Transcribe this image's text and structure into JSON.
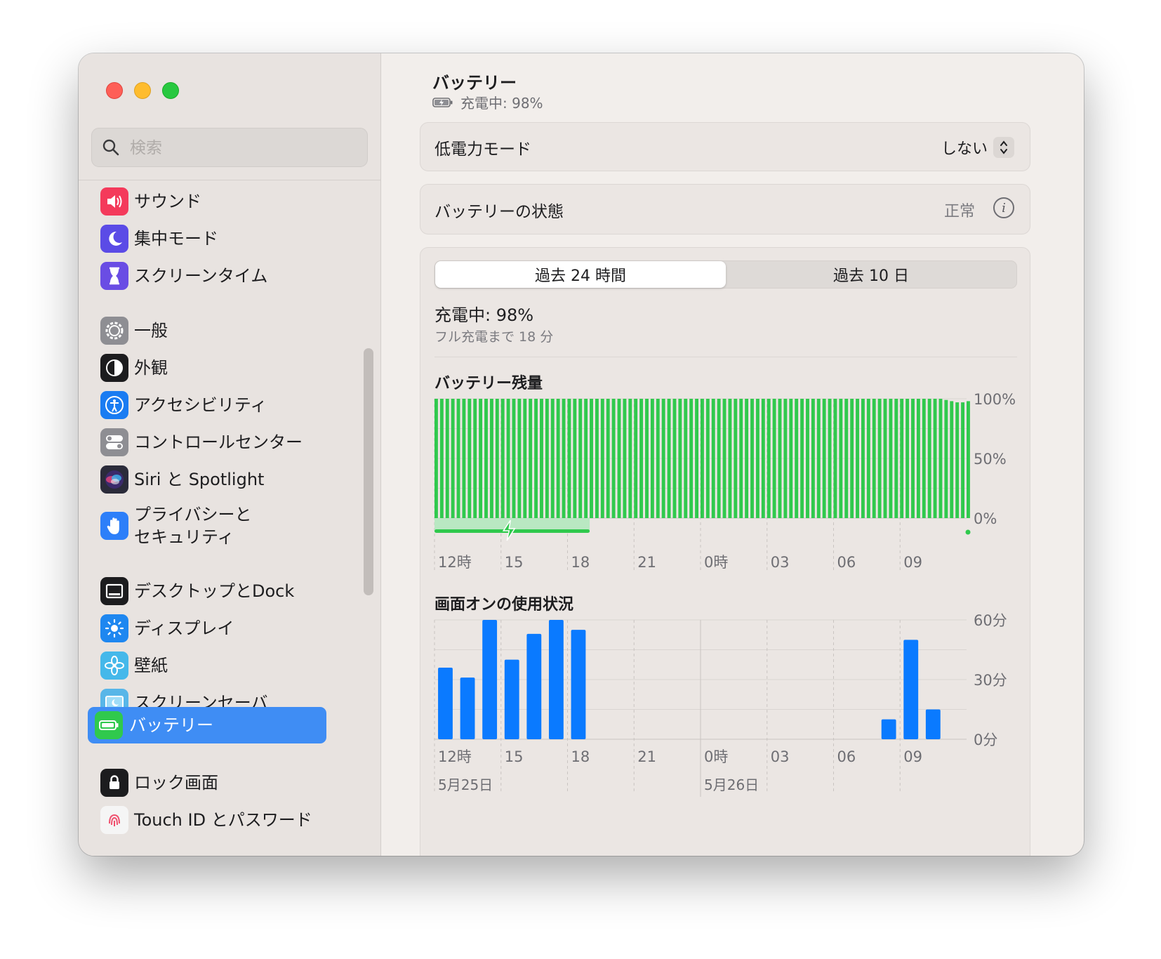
{
  "window": {
    "title": "バッテリー",
    "subtitle": "充電中: 98%"
  },
  "sidebar": {
    "search_placeholder": "検索",
    "items": [
      {
        "label": "サウンド",
        "icon": "speaker-icon",
        "color": "#f43a5b"
      },
      {
        "label": "集中モード",
        "icon": "moon-icon",
        "color": "#5b4be6"
      },
      {
        "label": "スクリーンタイム",
        "icon": "hourglass-icon",
        "color": "#6a4de4"
      },
      {
        "label": "一般",
        "icon": "gear-icon",
        "color": "#8e8e93"
      },
      {
        "label": "外観",
        "icon": "appearance-icon",
        "color": "#1c1c1e"
      },
      {
        "label": "アクセシビリティ",
        "icon": "accessibility-icon",
        "color": "#1a7cf2"
      },
      {
        "label": "コントロールセンター",
        "icon": "toggles-icon",
        "color": "#8e8e93"
      },
      {
        "label": "Siri と Spotlight",
        "icon": "siri-icon",
        "color": "#2b2b3a"
      },
      {
        "label": "プライバシーと\nセキュリティ",
        "icon": "hand-icon",
        "color": "#2d7ff9"
      },
      {
        "label": "デスクトップとDock",
        "icon": "dock-icon",
        "color": "#1c1c1e"
      },
      {
        "label": "ディスプレイ",
        "icon": "sun-icon",
        "color": "#1e87f0"
      },
      {
        "label": "壁紙",
        "icon": "flower-icon",
        "color": "#45b8ea"
      },
      {
        "label": "スクリーンセーバ",
        "icon": "screensaver-icon",
        "color": "#58b6e8"
      },
      {
        "label": "バッテリー",
        "icon": "battery-icon",
        "color": "#30c94d",
        "selected": true
      },
      {
        "label": "ロック画面",
        "icon": "lock-icon",
        "color": "#1c1c1e"
      },
      {
        "label": "Touch ID とパスワード",
        "icon": "fingerprint-icon",
        "color": "#f5f5f5"
      }
    ]
  },
  "low_power": {
    "label": "低電力モード",
    "value": "しない"
  },
  "health": {
    "label": "バッテリーの状態",
    "value": "正常"
  },
  "tabs": {
    "tab1": "過去 24 時間",
    "tab2": "過去 10 日",
    "active": 0
  },
  "charge": {
    "status": "充電中: 98%",
    "note": "フル充電まで 18 分"
  },
  "colors": {
    "accent": "#3f8df4",
    "battery_green": "#30c94d",
    "usage_blue": "#0a7aff"
  },
  "battery_chart": {
    "title": "バッテリー残量",
    "y_ticks": [
      "100%",
      "50%",
      "0%"
    ],
    "x_ticks": [
      "12時",
      "15",
      "18",
      "21",
      "0時",
      "03",
      "06",
      "09"
    ]
  },
  "usage_chart": {
    "title": "画面オンの使用状況",
    "y_ticks": [
      "60分",
      "30分",
      "0分"
    ],
    "x_ticks": [
      "12時",
      "15",
      "18",
      "21",
      "0時",
      "03",
      "06",
      "09"
    ],
    "date_labels": [
      "5月25日",
      "5月26日"
    ]
  },
  "chart_data": [
    {
      "type": "bar",
      "title": "バッテリー残量",
      "ylabel": "",
      "ylim": [
        0,
        100
      ],
      "x_ticks": [
        "12時",
        "15",
        "18",
        "21",
        "0時",
        "03",
        "06",
        "09"
      ],
      "x_range_hours": [
        12,
        35.5
      ],
      "bar_interval_minutes": 15,
      "values_note": "97 bars, every 15 min starting 12時",
      "values": [
        100,
        100,
        100,
        100,
        100,
        100,
        100,
        100,
        100,
        100,
        100,
        100,
        100,
        100,
        100,
        100,
        100,
        100,
        100,
        100,
        100,
        100,
        100,
        100,
        100,
        100,
        100,
        100,
        100,
        100,
        100,
        100,
        100,
        100,
        100,
        100,
        100,
        100,
        100,
        100,
        100,
        100,
        100,
        100,
        100,
        100,
        100,
        100,
        100,
        100,
        100,
        100,
        100,
        100,
        100,
        100,
        100,
        100,
        100,
        100,
        100,
        100,
        100,
        100,
        100,
        100,
        100,
        100,
        100,
        100,
        100,
        100,
        100,
        100,
        100,
        100,
        100,
        100,
        100,
        100,
        100,
        100,
        100,
        100,
        100,
        100,
        100,
        100,
        100,
        100,
        100,
        100,
        99,
        98,
        97,
        97,
        98
      ],
      "charging_periods": [
        [
          12,
          19
        ]
      ],
      "grid": true
    },
    {
      "type": "bar",
      "title": "画面オンの使用状況",
      "ylabel": "",
      "ylim": [
        0,
        60
      ],
      "x_ticks": [
        "12時",
        "15",
        "18",
        "21",
        "0時",
        "03",
        "06",
        "09"
      ],
      "bars": [
        {
          "hour": 12,
          "value": 36
        },
        {
          "hour": 13,
          "value": 31
        },
        {
          "hour": 14,
          "value": 60
        },
        {
          "hour": 15,
          "value": 40
        },
        {
          "hour": 16,
          "value": 53
        },
        {
          "hour": 17,
          "value": 60
        },
        {
          "hour": 18,
          "value": 55
        },
        {
          "hour": 32,
          "value": 10
        },
        {
          "hour": 33,
          "value": 50
        },
        {
          "hour": 34,
          "value": 15
        }
      ],
      "date_labels": [
        "5月25日",
        "5月26日"
      ],
      "grid": true
    }
  ]
}
